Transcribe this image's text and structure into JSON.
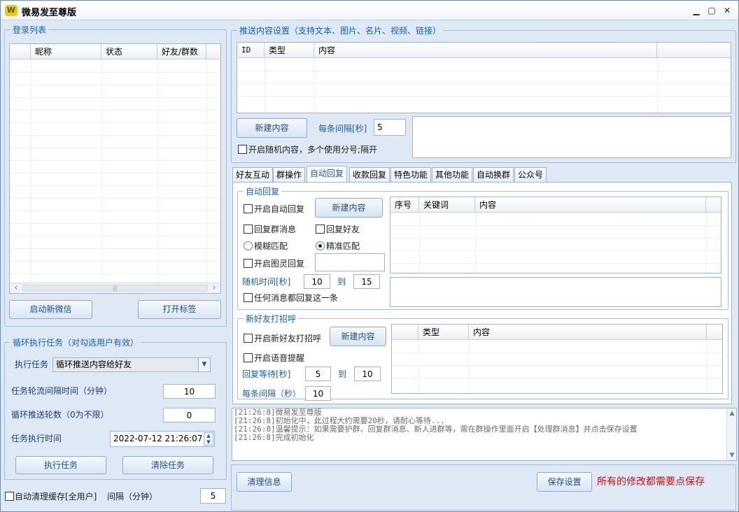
{
  "window": {
    "title": "微易发至尊版",
    "logo_text": "W",
    "minimize": "▁",
    "maximize": "▢",
    "close": "✕"
  },
  "login_list": {
    "legend": "登录列表",
    "columns": [
      "",
      "昵称",
      "状态",
      "好友/群数"
    ],
    "scroll_left": "‹",
    "scroll_right": "›",
    "scroll_thumb": "|||",
    "start_wechat": "启动新微信",
    "open_tags": "打开标签"
  },
  "loop_task": {
    "legend": "循环执行任务（对勾选用户有效）",
    "task_label": "执行任务",
    "task_value": "循环推送内容给好友",
    "interval_label": "任务轮流间隔时间（分钟）",
    "interval_value": "10",
    "rounds_label": "循环推送轮数（0为不限）",
    "rounds_value": "0",
    "time_label": "任务执行时间",
    "time_value": "2022-07-12 21:26:07",
    "run_button": "执行任务",
    "clear_button": "清除任务"
  },
  "bottom_left": {
    "auto_clear_label": "自动清理缓存[全用户]",
    "interval_label": "间隔（分钟）",
    "interval_value": "5"
  },
  "push": {
    "legend": "推送内容设置（支持文本、图片、名片、视频、链接）",
    "columns": [
      "ID",
      "类型",
      "内容"
    ],
    "new_button": "新建内容",
    "interval_label": "每条间隔[秒]",
    "interval_value": "5",
    "random_label": "开启随机内容，多个使用分号;隔开"
  },
  "tabs": {
    "items": [
      "好友互动",
      "群操作",
      "自动回复",
      "收款回复",
      "特色功能",
      "其他功能",
      "自动换群",
      "公众号"
    ],
    "active_index": 2
  },
  "auto_reply": {
    "legend": "自动回复",
    "enable_label": "开启自动回复",
    "new_button": "新建内容",
    "reply_group": "回复群消息",
    "reply_friend": "回复好友",
    "fuzzy": "模糊匹配",
    "exact": "精准匹配",
    "tuling": "开启图灵回复",
    "random_time_label": "随机时间[秒]",
    "random_from": "10",
    "to_label": "到",
    "random_to": "15",
    "any_message": "任何消息都回复这一条",
    "columns": [
      "序号",
      "关键词",
      "内容"
    ]
  },
  "greet": {
    "legend": "新好友打招呼",
    "enable_label": "开启新好友打招呼",
    "new_button": "新建内容",
    "voice_label": "开启语音提醒",
    "wait_label": "回复等待[秒]",
    "wait_from": "5",
    "to_label": "到",
    "wait_to": "10",
    "each_label": "每条间隔（秒）",
    "each_value": "10",
    "columns": [
      "",
      "类型",
      "内容"
    ]
  },
  "log": {
    "lines": [
      "[21:26:8]微易发至尊版",
      "[21:26:8]初始化中，此过程大约需要20秒，请耐心等待...",
      "[21:26:8]温馨提示：如果需要护群、回复群消息、新人进群等，需在群操作里面开启【处理群消息】并点击保存设置",
      "[21:26:8]完成初始化"
    ]
  },
  "footer": {
    "clear_info": "清理信息",
    "save_settings": "保存设置",
    "save_notice": "所有的修改都需要点保存",
    "notice_color": "#d01010"
  }
}
